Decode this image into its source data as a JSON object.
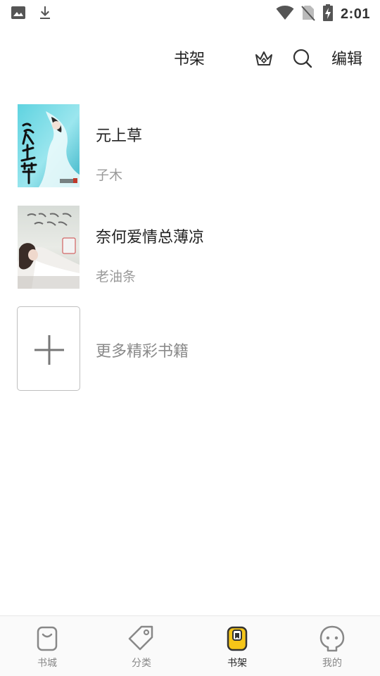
{
  "status_bar": {
    "time": "2:01",
    "icons": [
      "image-icon",
      "download-icon",
      "wifi-icon",
      "no-sim-icon",
      "battery-charging-icon"
    ]
  },
  "header": {
    "title": "书架",
    "edit_label": "编辑",
    "icons": [
      "crown-icon",
      "search-icon"
    ]
  },
  "books": [
    {
      "title": "元上草",
      "author": "子木"
    },
    {
      "title": "奈何爱情总薄凉",
      "author": "老油条"
    }
  ],
  "add_more": {
    "label": "更多精彩书籍"
  },
  "bottom_nav": {
    "items": [
      {
        "label": "书城",
        "icon": "bookstore-icon",
        "active": false
      },
      {
        "label": "分类",
        "icon": "tag-icon",
        "active": false
      },
      {
        "label": "书架",
        "icon": "bookshelf-icon",
        "active": true
      },
      {
        "label": "我的",
        "icon": "profile-icon",
        "active": false
      }
    ]
  },
  "colors": {
    "accent": "#f5c518",
    "text": "#222222",
    "muted": "#9a9a9a"
  }
}
